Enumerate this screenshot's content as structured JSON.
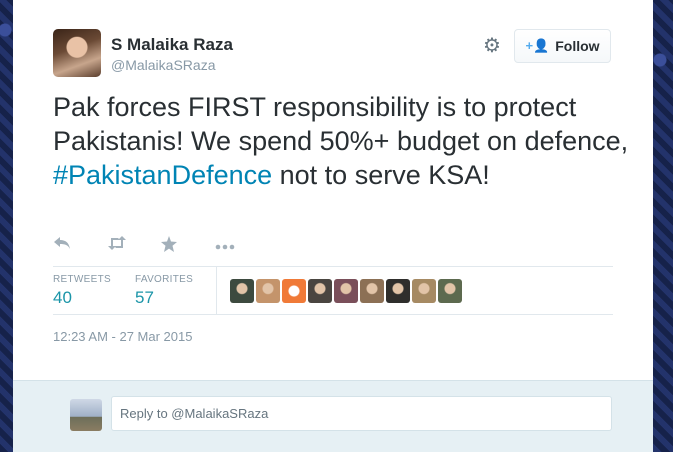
{
  "tweet": {
    "author_name": "S Malaika Raza",
    "author_handle": "@MalaikaSRaza",
    "text_part1": "Pak forces FIRST responsibility is to protect Pakistanis! We spend 50%+ budget on defence, ",
    "hashtag": "#PakistanDefence",
    "text_part2": " not to serve KSA!",
    "timestamp": "12:23 AM - 27 Mar 2015"
  },
  "header": {
    "follow_label": "Follow",
    "gear_icon": "gear-icon",
    "follow_icon": "add-user-icon"
  },
  "actions": {
    "reply_icon": "reply-icon",
    "retweet_icon": "retweet-icon",
    "favorite_icon": "star-icon",
    "more_icon": "more-icon"
  },
  "stats": {
    "retweets_label": "RETWEETS",
    "retweets_value": "40",
    "favorites_label": "FAVORITES",
    "favorites_value": "57"
  },
  "favoriters": [
    {
      "color": "#3d4a3f"
    },
    {
      "color": "#c4946b"
    },
    {
      "color": "#f07a38"
    },
    {
      "color": "#4a4540"
    },
    {
      "color": "#7a4f5a"
    },
    {
      "color": "#8c7055"
    },
    {
      "color": "#2f2e2c"
    },
    {
      "color": "#a68a63"
    },
    {
      "color": "#5d6a4f"
    }
  ],
  "reply": {
    "placeholder": "Reply to @MalaikaSRaza"
  },
  "colors": {
    "link": "#0084b4",
    "stat_value": "#1b95a8",
    "muted": "#8899a6"
  }
}
